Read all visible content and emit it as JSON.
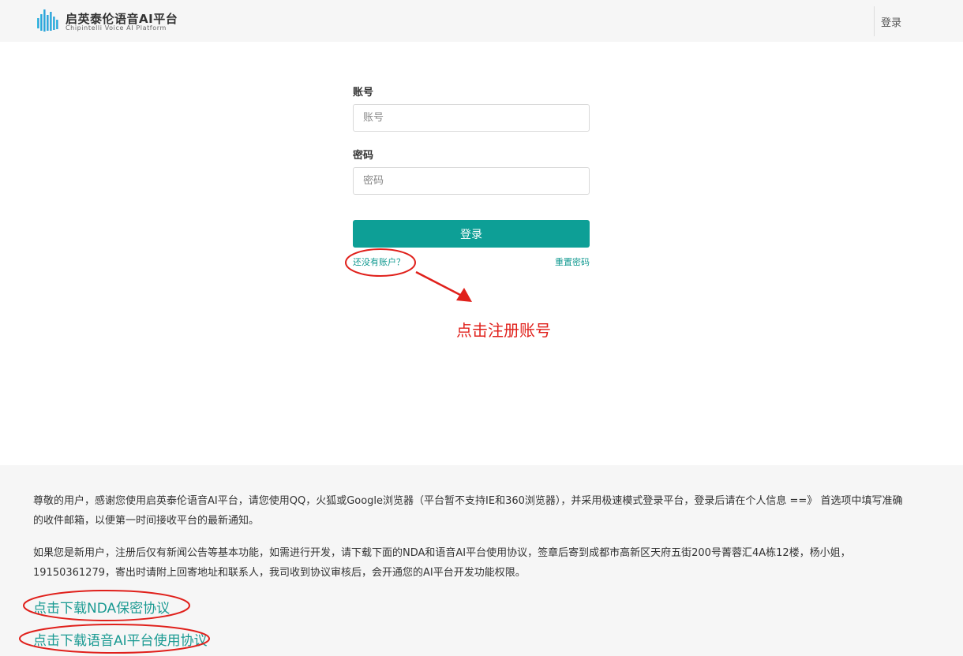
{
  "header": {
    "logo_title": "启英泰伦语音AI平台",
    "logo_subtitle": "Chipintelli Voice AI Platform",
    "login_label": "登录"
  },
  "form": {
    "account_label": "账号",
    "account_placeholder": "账号",
    "account_value": "",
    "password_label": "密码",
    "password_placeholder": "密码",
    "password_value": "",
    "login_button": "登录",
    "register_link": "还没有账户？",
    "reset_link": "重置密码"
  },
  "annotation": {
    "text": "点击注册账号",
    "color": "#e0201b"
  },
  "notice": {
    "paragraph1": "尊敬的用户，感谢您使用启英泰伦语音AI平台，请您使用QQ，火狐或Google浏览器（平台暂不支持IE和360浏览器），并采用极速模式登录平台，登录后请在个人信息   ==》  首选项中填写准确的收件邮箱，以便第一时间接收平台的最新通知。",
    "paragraph2": "如果您是新用户，注册后仅有新闻公告等基本功能，如需进行开发，请下载下面的NDA和语音AI平台使用协议，签章后寄到成都市高新区天府五街200号菁蓉汇4A栋12楼，杨小姐，19150361279，寄出时请附上回寄地址和联系人，我司收到协议审核后，会开通您的AI平台开发功能权限。",
    "download_nda": "点击下载NDA保密协议",
    "download_agreement": "点击下载语音AI平台使用协议"
  },
  "colors": {
    "accent": "#0d9f96",
    "link": "#129a91",
    "header_bg": "#f6f6f6"
  }
}
